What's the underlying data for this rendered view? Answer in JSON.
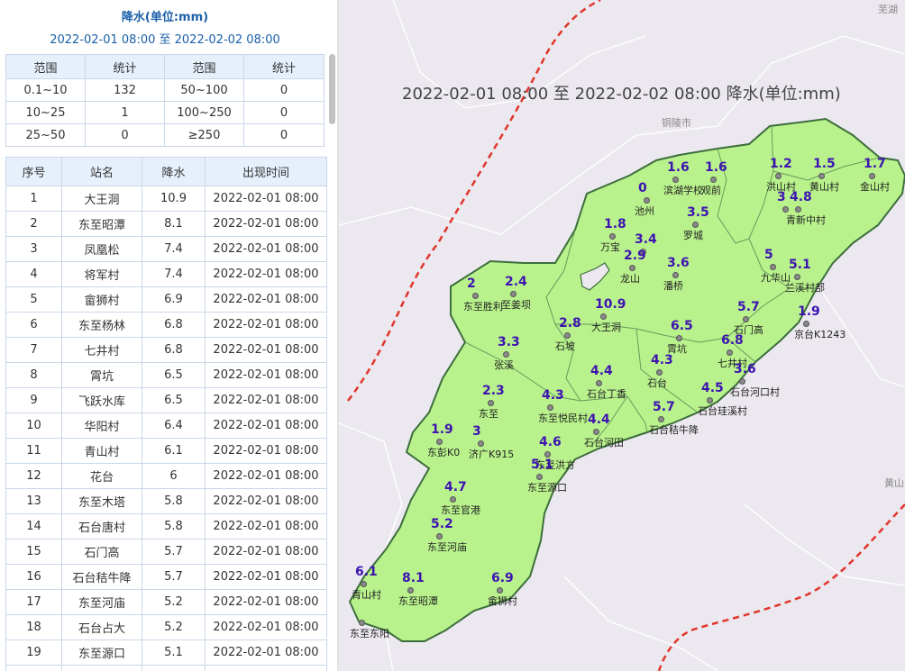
{
  "panel": {
    "title": "降水(单位:mm)",
    "range": "2022-02-01 08:00 至 2022-02-02 08:00"
  },
  "summary": {
    "headers": [
      "范围",
      "统计",
      "范围",
      "统计"
    ],
    "rows": [
      [
        "0.1~10",
        "132",
        "50~100",
        "0"
      ],
      [
        "10~25",
        "1",
        "100~250",
        "0"
      ],
      [
        "25~50",
        "0",
        "≥250",
        "0"
      ]
    ]
  },
  "stations_table": {
    "headers": [
      "序号",
      "站名",
      "降水",
      "出现时间"
    ],
    "rows": [
      [
        "1",
        "大王洞",
        "10.9",
        "2022-02-01 08:00"
      ],
      [
        "2",
        "东至昭潭",
        "8.1",
        "2022-02-01 08:00"
      ],
      [
        "3",
        "凤凰松",
        "7.4",
        "2022-02-01 08:00"
      ],
      [
        "4",
        "将军村",
        "7.4",
        "2022-02-01 08:00"
      ],
      [
        "5",
        "畲狮村",
        "6.9",
        "2022-02-01 08:00"
      ],
      [
        "6",
        "东至杨林",
        "6.8",
        "2022-02-01 08:00"
      ],
      [
        "7",
        "七井村",
        "6.8",
        "2022-02-01 08:00"
      ],
      [
        "8",
        "霄坑",
        "6.5",
        "2022-02-01 08:00"
      ],
      [
        "9",
        "飞跃水库",
        "6.5",
        "2022-02-01 08:00"
      ],
      [
        "10",
        "华阳村",
        "6.4",
        "2022-02-01 08:00"
      ],
      [
        "11",
        "青山村",
        "6.1",
        "2022-02-01 08:00"
      ],
      [
        "12",
        "花台",
        "6",
        "2022-02-01 08:00"
      ],
      [
        "13",
        "东至木塔",
        "5.8",
        "2022-02-01 08:00"
      ],
      [
        "14",
        "石台唐村",
        "5.8",
        "2022-02-01 08:00"
      ],
      [
        "15",
        "石门高",
        "5.7",
        "2022-02-01 08:00"
      ],
      [
        "16",
        "石台秸牛降",
        "5.7",
        "2022-02-01 08:00"
      ],
      [
        "17",
        "东至河庙",
        "5.2",
        "2022-02-01 08:00"
      ],
      [
        "18",
        "石台占大",
        "5.2",
        "2022-02-01 08:00"
      ],
      [
        "19",
        "东至源口",
        "5.1",
        "2022-02-01 08:00"
      ],
      [
        "20",
        "",
        "",
        ""
      ]
    ]
  },
  "map": {
    "title": "2022-02-01 08:00 至 2022-02-02 08:00 降水(单位:mm)",
    "colors": {
      "region_fill": "#b9f28c",
      "boundary": "#3c6e3c",
      "province_border": "#e0362c",
      "background": "#ece8ef",
      "value_text": "#3d14b0"
    },
    "background_labels": [
      "铜陵市",
      "芜湖",
      "黄山"
    ],
    "stations": [
      {
        "value": "1.6",
        "name": "滨湖学校"
      },
      {
        "value": "1.6",
        "name": "观前"
      },
      {
        "value": "0",
        "name": "池州"
      },
      {
        "value": "1.2",
        "name": "洪山村"
      },
      {
        "value": "1.5",
        "name": "黄山村"
      },
      {
        "value": "1.7",
        "name": "金山村"
      },
      {
        "value": "3",
        "name": ""
      },
      {
        "value": "4.8",
        "name": "青新中村"
      },
      {
        "value": "1.8",
        "name": "万宝"
      },
      {
        "value": "3.4",
        "name": ""
      },
      {
        "value": "2.9",
        "name": "龙山"
      },
      {
        "value": "3.5",
        "name": "罗城"
      },
      {
        "value": "3.6",
        "name": "潘桥"
      },
      {
        "value": "5",
        "name": "九华山"
      },
      {
        "value": "5.1",
        "name": "兰溪村部"
      },
      {
        "value": "2",
        "name": "东至胜利"
      },
      {
        "value": "2.4",
        "name": "至姜坝"
      },
      {
        "value": "10.9",
        "name": "大王洞"
      },
      {
        "value": "5.7",
        "name": "石门高"
      },
      {
        "value": "1.9",
        "name": "京台K1243"
      },
      {
        "value": "2.8",
        "name": "石坡"
      },
      {
        "value": "6.5",
        "name": "霄坑"
      },
      {
        "value": "6.8",
        "name": "七井村"
      },
      {
        "value": "3.3",
        "name": "张溪"
      },
      {
        "value": "4.4",
        "name": "石台丁香"
      },
      {
        "value": "4.3",
        "name": "石台"
      },
      {
        "value": "3.6",
        "name": "石台河口村"
      },
      {
        "value": "4.5",
        "name": "石台珪溪村"
      },
      {
        "value": "2.3",
        "name": "东至"
      },
      {
        "value": "4.3",
        "name": "东至悦民村"
      },
      {
        "value": "5.7",
        "name": "石台秸牛降"
      },
      {
        "value": "4.4",
        "name": "石台河田"
      },
      {
        "value": "1.9",
        "name": "东彭K0"
      },
      {
        "value": "3",
        "name": "济广K915"
      },
      {
        "value": "4.6",
        "name": "东至洪方"
      },
      {
        "value": "5.1",
        "name": "东至源口"
      },
      {
        "value": "4.7",
        "name": "东至官港"
      },
      {
        "value": "5.2",
        "name": "东至河庙"
      },
      {
        "value": "6.9",
        "name": "畲狮村"
      },
      {
        "value": "6.1",
        "name": "青山村"
      },
      {
        "value": "8.1",
        "name": "东至昭潭"
      },
      {
        "value": "",
        "name": "东至东阳"
      }
    ]
  }
}
